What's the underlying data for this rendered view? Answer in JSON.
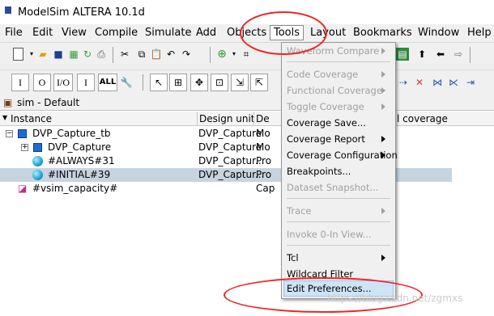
{
  "window": {
    "title": "ModelSim ALTERA 10.1d"
  },
  "menubar": {
    "items": [
      "File",
      "Edit",
      "View",
      "Compile",
      "Simulate",
      "Add",
      "Objects",
      "Tools",
      "Layout",
      "Bookmarks",
      "Window",
      "Help"
    ]
  },
  "toolbar1": {
    "icons": [
      "new-file-icon",
      "open-folder-icon",
      "save-icon",
      "compile-icon",
      "recompile-icon",
      "print-icon",
      "cut-icon",
      "copy-icon",
      "paste-icon",
      "undo-icon",
      "redo-icon",
      "find-icon",
      "binoculars-icon"
    ]
  },
  "toolbar2": {
    "boxes": [
      "I",
      "O",
      "I/O",
      "I",
      "ALL"
    ]
  },
  "panel": {
    "title": "sim - Default",
    "columns": {
      "instance": "Instance",
      "design_unit": "Design unit",
      "design_type": "De",
      "coverage": "l coverage"
    },
    "rows": [
      {
        "instance": "DVP_Capture_tb",
        "design_unit": "DVP_Capture",
        "type": "Mo"
      },
      {
        "instance": "DVP_Capture",
        "design_unit": "DVP_Capture",
        "type": "Mo"
      },
      {
        "instance": "#ALWAYS#31",
        "design_unit": "DVP_Captur...",
        "type": "Pro"
      },
      {
        "instance": "#INITIAL#39",
        "design_unit": "DVP_Captur...",
        "type": "Pro"
      },
      {
        "instance": "#vsim_capacity#",
        "design_unit": "",
        "type": "Cap"
      }
    ]
  },
  "tools_menu": {
    "items": {
      "waveform_compare": "Waveform Compare",
      "code_coverage": "Code Coverage",
      "functional_coverage": "Functional Coverage",
      "toggle_coverage": "Toggle Coverage",
      "coverage_save": "Coverage Save...",
      "coverage_report": "Coverage Report",
      "coverage_configuration": "Coverage Configuration",
      "breakpoints": "Breakpoints...",
      "dataset_snapshot": "Dataset Snapshot...",
      "trace": "Trace",
      "invoke_0in": "Invoke 0-In View...",
      "tcl": "Tcl",
      "wildcard_filter": "Wildcard Filter",
      "edit_preferences": "Edit Preferences..."
    }
  },
  "watermark": "https://blog.csdn.net/zgmxs",
  "colors": {
    "highlight_ellipse": "#ef2424",
    "selected_row": "#c6d4e0",
    "menu_hover": "#cde4f7"
  }
}
